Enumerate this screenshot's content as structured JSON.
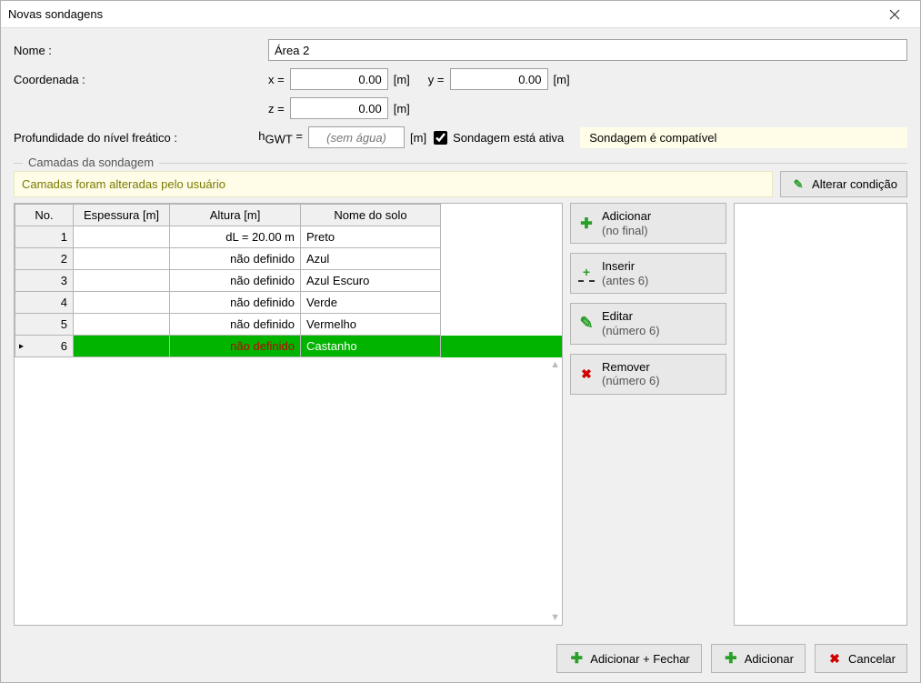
{
  "title": "Novas sondagens",
  "labels": {
    "nome": "Nome :",
    "coord": "Coordenada :",
    "x": "x =",
    "y": "y =",
    "z": "z =",
    "unit_m": "[m]",
    "gwt_label": "Profundidade do nível freático :",
    "hgwt": "hGWT =",
    "gwt_placeholder": "(sem água)",
    "active_chk": "Sondagem está ativa",
    "status": "Sondagem é compatível"
  },
  "inputs": {
    "nome": "Área 2",
    "x": "0.00",
    "y": "0.00",
    "z": "0.00"
  },
  "fieldset": {
    "legend": "Camadas da sondagem",
    "warn": "Camadas foram alteradas pelo usuário",
    "alter_btn": "Alterar condição"
  },
  "table": {
    "headers": {
      "no": "No.",
      "esp": "Espessura [m]",
      "alt": "Altura [m]",
      "nome": "Nome do solo"
    },
    "rows": [
      {
        "no": "1",
        "esp": "",
        "alt": "dL = 20.00 m",
        "nome": "Preto",
        "sel": false
      },
      {
        "no": "2",
        "esp": "",
        "alt": "não definido",
        "nome": "Azul",
        "sel": false
      },
      {
        "no": "3",
        "esp": "",
        "alt": "não definido",
        "nome": "Azul Escuro",
        "sel": false
      },
      {
        "no": "4",
        "esp": "",
        "alt": "não definido",
        "nome": "Verde",
        "sel": false
      },
      {
        "no": "5",
        "esp": "",
        "alt": "não definido",
        "nome": "Vermelho",
        "sel": false
      },
      {
        "no": "6",
        "esp": "",
        "alt": "não definido",
        "nome": "Castanho",
        "sel": true
      }
    ]
  },
  "sidebtns": {
    "add": {
      "t1": "Adicionar",
      "t2": "(no final)"
    },
    "insert": {
      "t1": "Inserir",
      "t2": "(antes 6)"
    },
    "edit": {
      "t1": "Editar",
      "t2": "(número 6)"
    },
    "remove": {
      "t1": "Remover",
      "t2": "(número 6)"
    }
  },
  "footer": {
    "add_close": "Adicionar + Fechar",
    "add": "Adicionar",
    "cancel": "Cancelar"
  }
}
